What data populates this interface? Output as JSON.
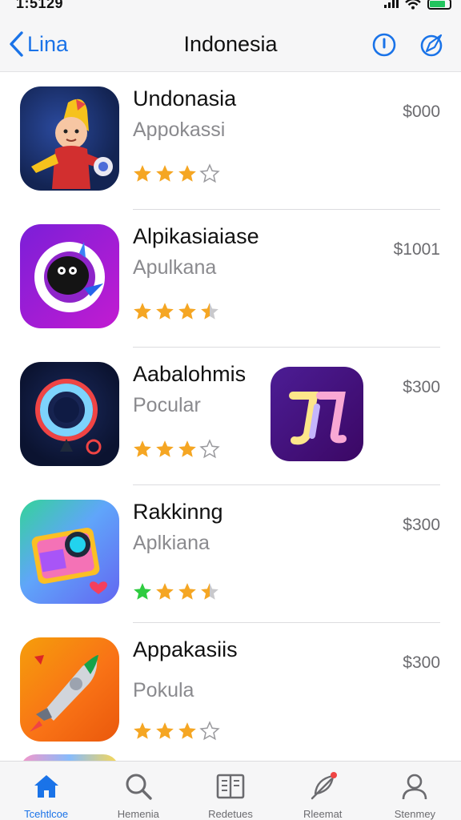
{
  "status_bar": {
    "time": "1:5129"
  },
  "nav": {
    "back_label": "Lina",
    "title": "Indonesia"
  },
  "apps": [
    {
      "name": "Undonasia",
      "category": "Appokassi",
      "price": "$000",
      "rating": 3
    },
    {
      "name": "Alpikasiaiase",
      "category": "Apulkana",
      "price": "$1001",
      "rating": 3.5
    },
    {
      "name": "Aabalohmis",
      "category": "Pocular",
      "price": "$300",
      "rating": 3
    },
    {
      "name": "Rakkinng",
      "category": "Aplkiana",
      "price": "$300",
      "rating": 3.5
    },
    {
      "name": "Appakasiis",
      "category": "Pokula",
      "price": "$300",
      "rating": 3
    }
  ],
  "tabs": [
    {
      "label": "Tcehtlcoe",
      "icon": "home-icon",
      "active": true
    },
    {
      "label": "Hemenia",
      "icon": "search-icon",
      "active": false
    },
    {
      "label": "Redetues",
      "icon": "book-icon",
      "active": false
    },
    {
      "label": "Rleemat",
      "icon": "feather-icon",
      "active": false
    },
    {
      "label": "Stenmey",
      "icon": "person-icon",
      "active": false
    }
  ],
  "colors": {
    "accent": "#1a73e8",
    "star": "#f5a623",
    "star_green": "#2ecc40"
  }
}
